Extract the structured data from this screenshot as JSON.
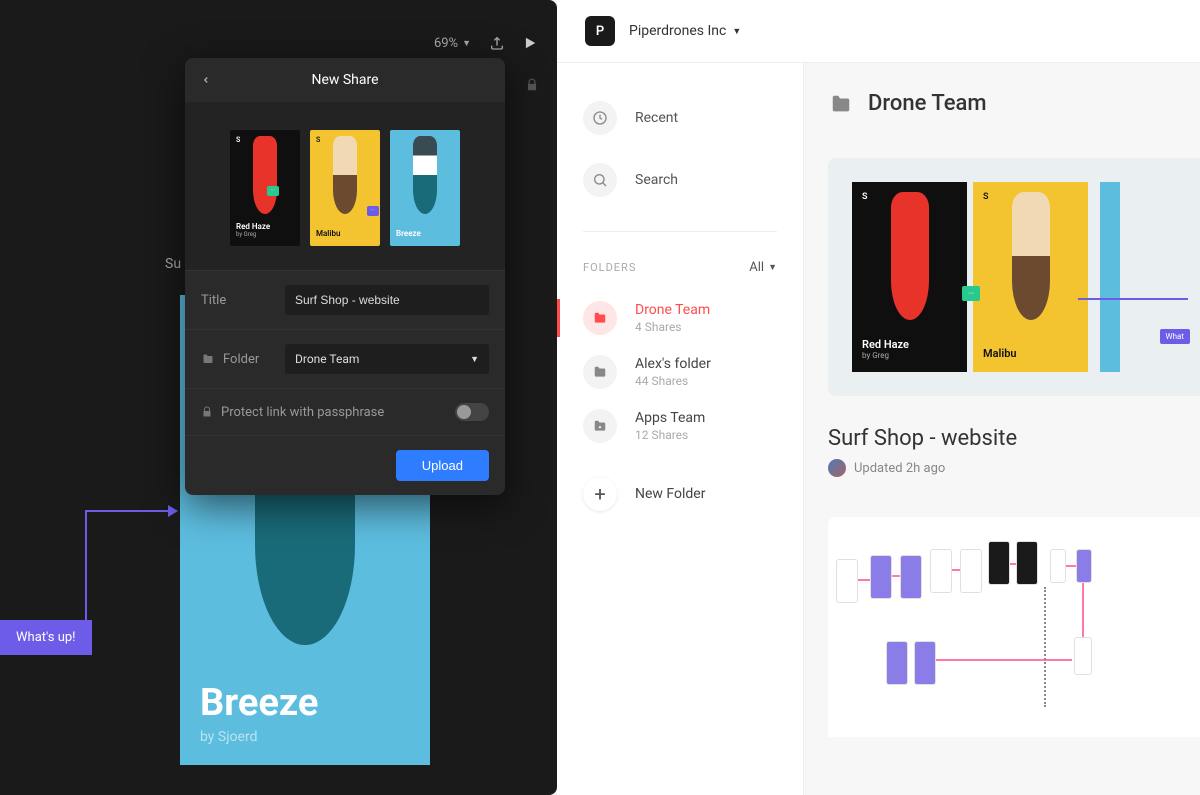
{
  "left": {
    "zoom": "69%",
    "suText": "Su",
    "whatsUp": "What's up!",
    "breezeCard": {
      "title": "Breeze",
      "by": "by Sjoerd"
    }
  },
  "modal": {
    "title": "New Share",
    "thumbs": [
      {
        "name": "Red Haze",
        "sub": "by Greg",
        "s": "S"
      },
      {
        "name": "Malibu",
        "sub": "",
        "s": "S"
      },
      {
        "name": "Breeze",
        "sub": "",
        "s": ""
      }
    ],
    "titleLabel": "Title",
    "titleValue": "Surf Shop - website",
    "folderLabel": "Folder",
    "folderValue": "Drone Team",
    "protectLabel": "Protect link with passphrase",
    "uploadLabel": "Upload"
  },
  "right": {
    "orgLetter": "P",
    "orgName": "Piperdrones Inc",
    "nav": {
      "recent": "Recent",
      "search": "Search"
    },
    "foldersHeader": "FOLDERS",
    "filter": "All",
    "folders": [
      {
        "name": "Drone Team",
        "shares": "4 Shares"
      },
      {
        "name": "Alex's folder",
        "shares": "44 Shares"
      },
      {
        "name": "Apps Team",
        "shares": "12 Shares"
      }
    ],
    "newFolder": "New Folder",
    "contentTitle": "Drone Team",
    "previewCards": [
      {
        "name": "Red Haze",
        "sub": "by Greg",
        "s": "S"
      },
      {
        "name": "Malibu",
        "sub": "",
        "s": "S"
      }
    ],
    "projectName": "Surf Shop - website",
    "projectUpdated": "Updated 2h ago"
  }
}
